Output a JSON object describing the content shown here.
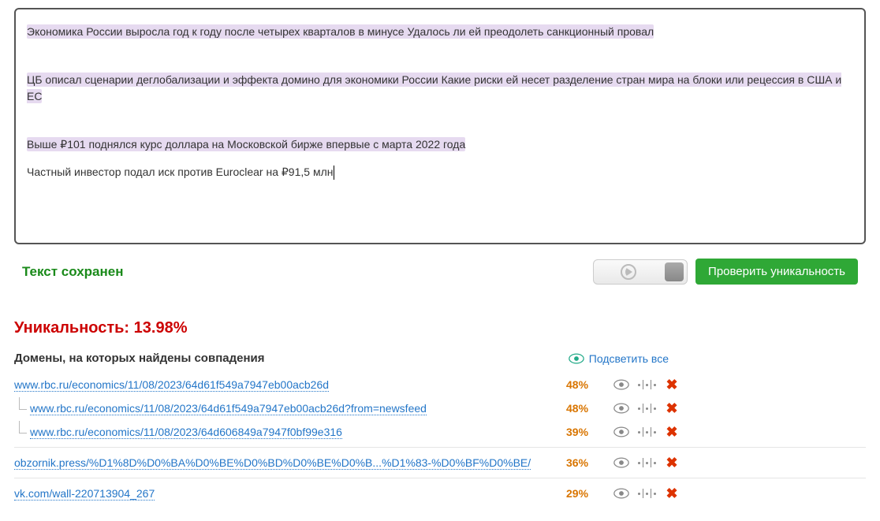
{
  "editor": {
    "paragraphs": [
      {
        "highlighted": true,
        "text": "Экономика России выросла год к году после четырех кварталов в минусе Удалось ли ей преодолеть санкционный провал"
      },
      {
        "highlighted": true,
        "text": "ЦБ описал сценарии деглобализации и эффекта домино для экономики России Какие риски ей несет разделение стран мира на блоки или рецессия в США и ЕС"
      },
      {
        "highlighted": true,
        "text": "Выше ₽101 поднялся курс доллара на Московской бирже впервые с марта 2022 года"
      },
      {
        "highlighted": false,
        "text": "Частный инвестор подал иск против Euroclear на ₽91,5 млн"
      }
    ]
  },
  "status": {
    "saved_label": "Текст сохранен"
  },
  "buttons": {
    "check_unique": "Проверить уникальность"
  },
  "uniqueness": {
    "label": "Уникальность:",
    "value": "13.98%"
  },
  "domains": {
    "heading": "Домены, на которых найдены совпадения",
    "highlight_all": "Подсветить все",
    "rows": [
      {
        "url": "www.rbc.ru/economics/11/08/2023/64d61f549a7947eb00acb26d",
        "percent": "48%",
        "child": false
      },
      {
        "url": "www.rbc.ru/economics/11/08/2023/64d61f549a7947eb00acb26d?from=newsfeed",
        "percent": "48%",
        "child": true
      },
      {
        "url": "www.rbc.ru/economics/11/08/2023/64d606849a7947f0bf99e316",
        "percent": "39%",
        "child": true
      },
      {
        "url": "obzornik.press/%D1%8D%D0%BA%D0%BE%D0%BD%D0%BE%D0%B...%D1%83-%D0%BF%D0%BE/",
        "percent": "36%",
        "child": false
      },
      {
        "url": "vk.com/wall-220713904_267",
        "percent": "29%",
        "child": false
      }
    ]
  }
}
